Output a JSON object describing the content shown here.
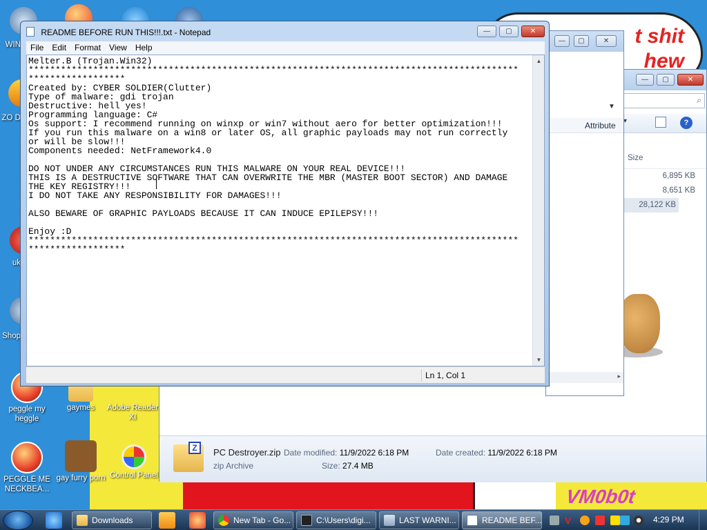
{
  "desktop": {
    "wallpaper_text": "t shit hew",
    "wallpaper_logo": "VM0b0t",
    "icons": [
      {
        "label": "peggle my heggle"
      },
      {
        "label": "gaymes"
      },
      {
        "label": "Adobe Reader XI"
      },
      {
        "label": "PEGGLE ME NECKBEA..."
      },
      {
        "label": "gay furry porn"
      },
      {
        "label": "Control Panel"
      }
    ],
    "partial_labels": [
      "WIN",
      "ZO D",
      "uk",
      "Shop"
    ]
  },
  "notepad": {
    "title": "README BEFORE RUN THIS!!!.txt - Notepad",
    "menu": [
      "File",
      "Edit",
      "Format",
      "View",
      "Help"
    ],
    "content": "Melter.B (Trojan.Win32)\n*******************************************************************************************\n******************\nCreated by: CYBER SOLDIER(Clutter)\nType of malware: gdi trojan\nDestructive: hell yes!\nProgramming language: C#\nOs support: I recommend running on winxp or win7 without aero for better optimization!!!\nIf you run this malware on a win8 or later OS, all graphic payloads may not run correctly\nor will be slow!!!\nComponents needed: NetFramework4.0\n\nDO NOT UNDER ANY CIRCUMSTANCES RUN THIS MALWARE ON YOUR REAL DEVICE!!!\nTHIS IS A DESTRUCTIVE SOFTWARE THAT CAN OVERWRITE THE MBR (MASTER BOOT SECTOR) AND DAMAGE\nTHE KEY REGISTRY!!!\nI DO NOT TAKE ANY RESPONSIBILITY FOR DAMAGES!!!\n\nALSO BEWARE OF GRAPHIC PAYLOADS BECAUSE IT CAN INDUCE EPILEPSY!!!\n\nEnjoy :D\n*******************************************************************************************\n******************",
    "status_position": "Ln 1, Col 1"
  },
  "explorer": {
    "column_attributes": "Attribute",
    "column_size": "Size",
    "sizes": [
      "6,895 KB",
      "8,651 KB",
      "28,122 KB"
    ],
    "details": {
      "file_name": "PC Destroyer.zip",
      "file_type": "zip Archive",
      "date_modified_label": "Date modified:",
      "date_modified": "11/9/2022 6:18 PM",
      "date_created_label": "Date created:",
      "date_created": "11/9/2022 6:18 PM",
      "size_label": "Size:",
      "size": "27.4 MB"
    }
  },
  "taskbar": {
    "tasks": [
      {
        "label": "Downloads"
      },
      {
        "label": "New Tab - Go..."
      },
      {
        "label": "C:\\Users\\digi..."
      },
      {
        "label": "LAST WARNI..."
      },
      {
        "label": "README BEF..."
      }
    ],
    "clock": "4:29 PM"
  },
  "colors": {
    "desktop_bg": "#2f8fd8",
    "wallpaper_red_text": "#e52222",
    "taskbar": "#1b3553"
  }
}
